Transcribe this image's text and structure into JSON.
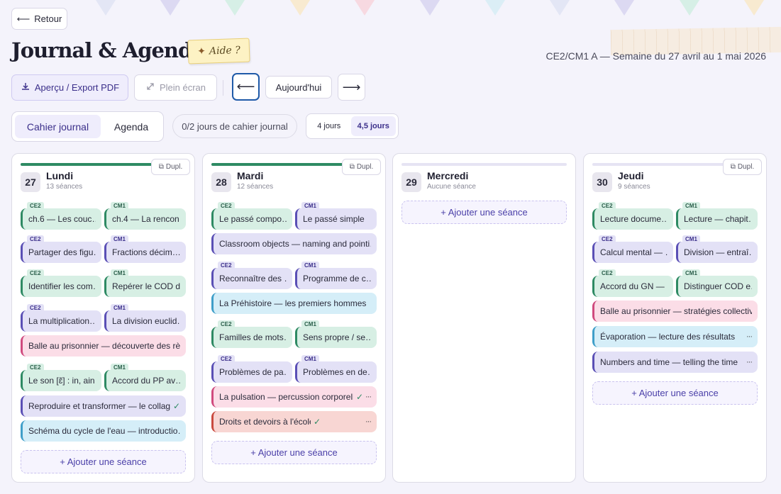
{
  "nav": {
    "back_label": "Retour",
    "back_arrow": "⟵",
    "title": "Journal & Agenda",
    "help_label": "Aide ?",
    "help_icon": "✦",
    "subtitle": "CE2/CM1 A — Semaine du 27 avril au 1 mai 2026"
  },
  "toolbar": {
    "export_label": "Aperçu / Export PDF",
    "fullscreen_label": "Plein écran",
    "prev_arrow": "⟵",
    "today_label": "Aujourd'hui",
    "next_arrow": "⟶"
  },
  "tabs": {
    "journal": "Cahier journal",
    "agenda": "Agenda",
    "progress": "0/2 jours de cahier journal",
    "four_days": "4 jours",
    "four_half_days": "4,5 jours"
  },
  "colors": {
    "accent": "#3b2f8a",
    "french_green": "#2e8a63",
    "math_purple": "#5a4fb5",
    "pink": "#d04a7e",
    "blue": "#3f9fc9",
    "red": "#c94a3f"
  },
  "common": {
    "dupl_label": "Dupl.",
    "add_label": "+ Ajouter une séance",
    "ce2": "CE2",
    "cm1": "CM1",
    "more": "···",
    "check": "✓"
  },
  "days": [
    {
      "num": "27",
      "name": "Lundi",
      "count": "13 séances",
      "progress": 0.9,
      "rows": [
        {
          "pair": [
            "ch.6 — Les couc…",
            "ch.4 — La rencon…"
          ]
        },
        {
          "pair": [
            "Partager des figu…",
            "Fractions décim…"
          ]
        },
        {
          "pair": [
            "Identifier les com…",
            "Repérer le COD d…"
          ]
        },
        {
          "pair": [
            "La multiplication…",
            "La division euclid…"
          ]
        },
        {
          "single": "Balle au prisonnier — découverte des rè…"
        },
        {
          "pair": [
            "Le son [ɛ̃] : in, ain…",
            "Accord du PP av…"
          ]
        },
        {
          "single": "Reproduire et transformer — le collage"
        },
        {
          "single": "Schéma du cycle de l'eau — introductio…"
        }
      ]
    },
    {
      "num": "28",
      "name": "Mardi",
      "count": "12 séances",
      "progress": 0.8,
      "rows": [
        {
          "pair": [
            "Le passé compo…",
            "Le passé simple"
          ]
        },
        {
          "single": "Classroom objects — naming and pointi…"
        },
        {
          "pair": [
            "Reconnaître des …",
            "Programme de c…"
          ]
        },
        {
          "single": "La Préhistoire — les premiers hommes"
        },
        {
          "pair": [
            "Familles de mots…",
            "Sens propre / se…"
          ]
        },
        {
          "pair": [
            "Problèmes de pa…",
            "Problèmes en de…"
          ]
        },
        {
          "single": "La pulsation — percussion corporelle"
        },
        {
          "single": "Droits et devoirs à l'école"
        }
      ]
    },
    {
      "num": "29",
      "name": "Mercredi",
      "count": "Aucune séance",
      "progress": 0
    },
    {
      "num": "30",
      "name": "Jeudi",
      "count": "9 séances",
      "progress": 0,
      "rows": [
        {
          "pair": [
            "Lecture docume…",
            "Lecture — chapit…"
          ]
        },
        {
          "pair": [
            "Calcul mental — …",
            "Division — entraî…"
          ]
        },
        {
          "pair": [
            "Accord du GN — …",
            "Distinguer COD e…"
          ]
        },
        {
          "single": "Balle au prisonnier — stratégies collectiv…"
        },
        {
          "single": "Évaporation — lecture des résultats"
        },
        {
          "single": "Numbers and time — telling the time"
        }
      ]
    }
  ]
}
